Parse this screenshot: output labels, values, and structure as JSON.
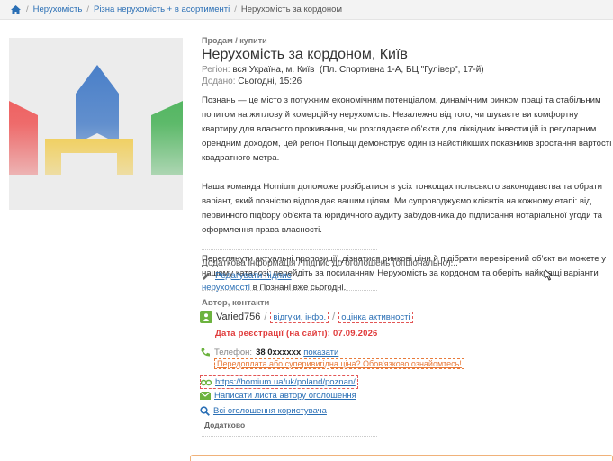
{
  "breadcrumb": {
    "items": [
      "Нерухомість",
      "Різна нерухомість + в асортименті"
    ],
    "current": "Нерухомість за кордоном"
  },
  "listing": {
    "category": "Продам / купити",
    "title": "Нерухомість за кордоном, Київ",
    "region_label": "Регіон:",
    "region_value": "вся Україна, м. Київ",
    "address": "(Пл. Спортивна 1-А, БЦ \"Гулівер\", 17-й)",
    "added_label": "Додано:",
    "added_value": "Сьогодні, 15:26",
    "description": [
      "Познань — це місто з потужним економічним потенціалом, динамічним ринком праці та стабільним попитом на житлову й комерційну нерухомість. Незалежно від того, чи шукаєте ви комфортну квартиру для власного проживання, чи розглядаєте об'єкти для ліквідних інвестицій із регулярним орендним доходом, цей регіон Польщі демонструє один із найстійкіших показників зростання вартості квадратного метра.",
      "Наша команда Homium допоможе розібратися в усіх тонкощах польського законодавства та обрати варіант, який повністю відповідає вашим цілям. Ми супроводжуємо клієнтів на кожному етапі: від первинного підбору об'єкта та юридичного аудиту забудовника до підписання нотаріальної угоди та оформлення права власності."
    ],
    "description_last_before": "Переглянути актуальні пропозиції, дізнатися ринкові ціни й підібрати перевірений об'єкт ви можете у нашому каталозі: перейдіть за посиланням Нерухомість за кордоном та оберіть найкращі варіанти ",
    "description_last_link": "нерухомості",
    "description_last_after": " в Познані вже сьогодні."
  },
  "extra": {
    "info_text": "Додаткова інформація / підпис до оголошень (опціонально)...",
    "edit_label": "Редагувати підпис"
  },
  "author": {
    "header": "Автор, контакти",
    "username": "Varied756",
    "reviews_link": "відгуки, інфо.",
    "activity_link": "оцінка активності",
    "reg_label": "Дата реєстрації (на сайті):",
    "reg_date": "07.09.2026",
    "phone_label": "Телефон:",
    "phone_value": "38 0xxxxxx",
    "phone_show": "показати",
    "warning": "Передоплата або суперивигідна ціна? Обов'язково ознайомтесь!",
    "website": "https://homium.ua/uk/poland/poznan/",
    "write_letter": "Написати листа автору оголошення",
    "all_ads": "Всі оголошення користувача",
    "more_label": "Додатково"
  },
  "colors": {
    "link": "#2a6fb5",
    "accent_red": "#e03a3a",
    "accent_orange": "#e87a3a",
    "green": "#6cb33f"
  }
}
